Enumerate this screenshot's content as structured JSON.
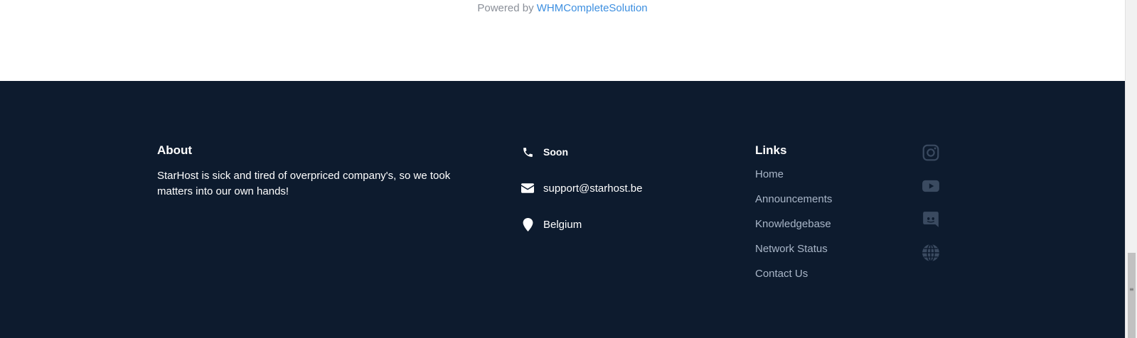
{
  "powered": {
    "prefix": "Powered by",
    "link": "WHMCompleteSolution"
  },
  "about": {
    "heading": "About",
    "text": "StarHost is sick and tired of overpriced company's, so we took matters into our own hands!"
  },
  "contact": {
    "items": [
      {
        "icon": "phone-icon",
        "text": "Soon"
      },
      {
        "icon": "envelope-icon",
        "text": "support@starhost.be"
      },
      {
        "icon": "map-marker-icon",
        "text": "Belgium"
      }
    ]
  },
  "links": {
    "heading": "Links",
    "items": [
      "Home",
      "Announcements",
      "Knowledgebase",
      "Network Status",
      "Contact Us"
    ]
  },
  "social": {
    "icons": [
      "instagram-icon",
      "youtube-icon",
      "discord-icon",
      "globe-icon"
    ]
  },
  "colors": {
    "footer_bg": "#0d1b2e",
    "link_accent": "#3d8fe0",
    "link_text": "#a9b6c8",
    "social_icon": "#3a4a60"
  }
}
